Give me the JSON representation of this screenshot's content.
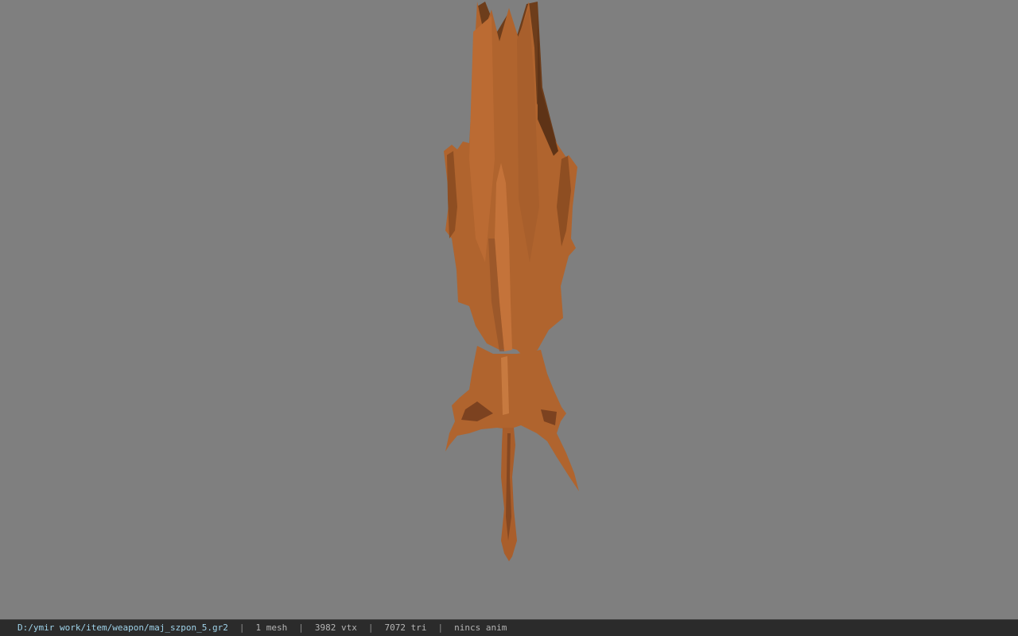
{
  "viewport": {
    "background_color": "#7f7f7f",
    "model_color": "#b0642e",
    "model_shadow_color": "#6a3a18",
    "model_highlight_color": "#c9783c"
  },
  "status_bar": {
    "file_path": "D:/ymir work/item/weapon/maj_szpon_5.gr2",
    "separator": "|",
    "mesh_count": "1 mesh",
    "vertex_count": "3982 vtx",
    "triangle_count": "7072 tri",
    "anim_status": "nincs anim"
  }
}
